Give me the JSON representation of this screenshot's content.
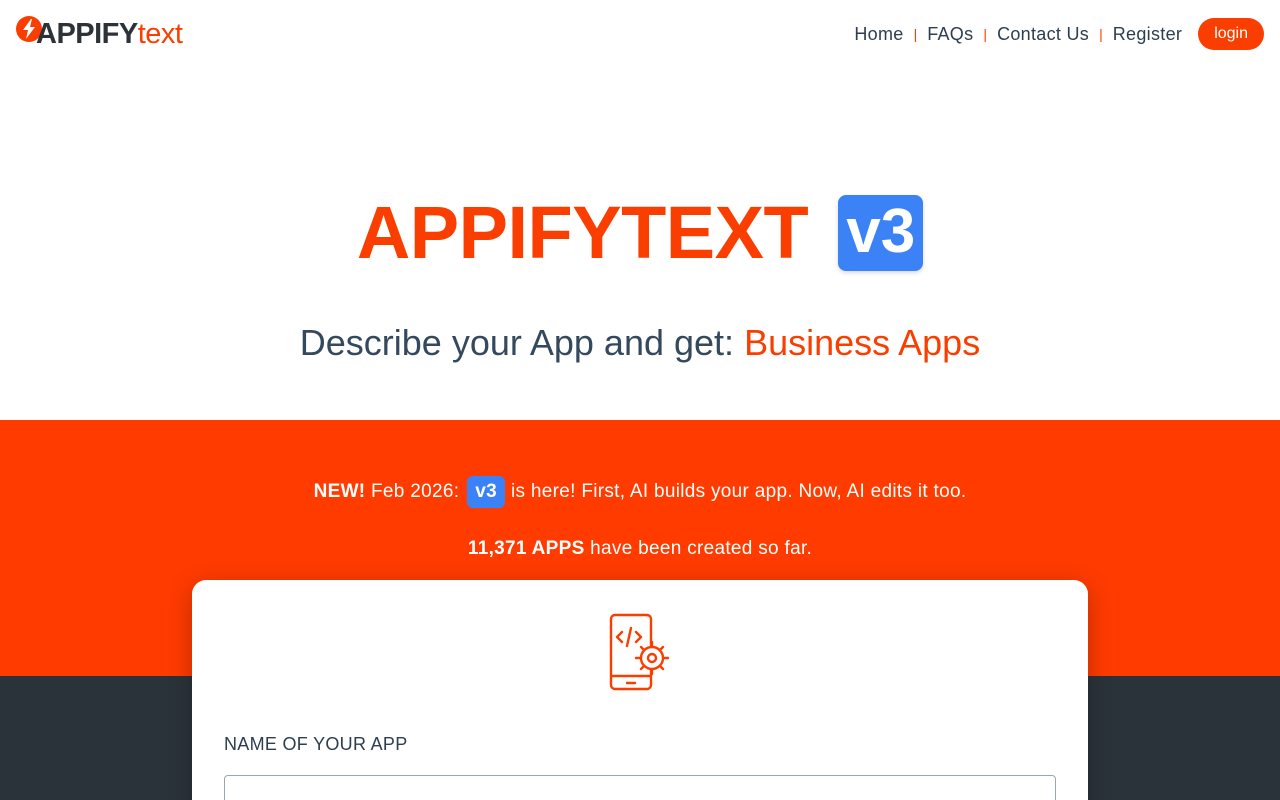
{
  "header": {
    "logo": {
      "brand": "APPIFY",
      "suffix": "text",
      "icon": "lightning-bolt-icon"
    },
    "nav": [
      {
        "label": "Home"
      },
      {
        "label": "FAQs"
      },
      {
        "label": "Contact Us"
      },
      {
        "label": "Register"
      }
    ],
    "separator": "|",
    "login_label": "login"
  },
  "hero": {
    "title": "APPIFYTEXT",
    "version_badge": "v3",
    "subtitle_prefix": "Describe your App and get:",
    "subtitle_highlight": "Business Apps"
  },
  "announcement": {
    "new_label": "NEW!",
    "date": "Feb 2026:",
    "badge": "v3",
    "text": "is here! First, AI builds your app. Now, AI edits it too."
  },
  "stats": {
    "count": "11,371 APPS",
    "text": "have been created so far."
  },
  "form": {
    "icon": "mobile-code-settings-icon",
    "name_label": "NAME OF YOUR APP",
    "name_value": "",
    "name_placeholder": ""
  },
  "colors": {
    "accent": "#fa3e00",
    "band": "#ff3b00",
    "badge_blue": "#3b82f6",
    "dark": "#2b333a"
  }
}
